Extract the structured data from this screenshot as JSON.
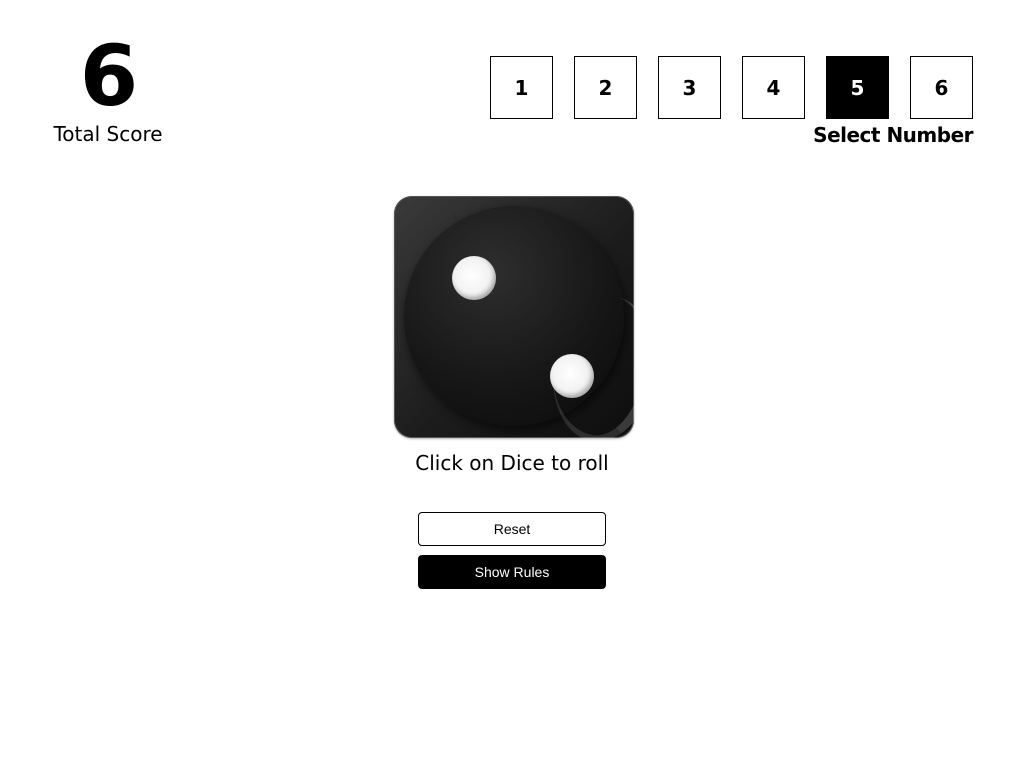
{
  "score": {
    "value": "6",
    "label": "Total Score"
  },
  "number_select": {
    "options": [
      "1",
      "2",
      "3",
      "4",
      "5",
      "6"
    ],
    "selected": "5",
    "label": "Select Number"
  },
  "dice": {
    "face_value": 2,
    "instruction": "Click on Dice to roll"
  },
  "actions": {
    "reset_label": "Reset",
    "rules_label": "Show Rules"
  },
  "colors": {
    "primary": "#000000",
    "background": "#ffffff"
  }
}
